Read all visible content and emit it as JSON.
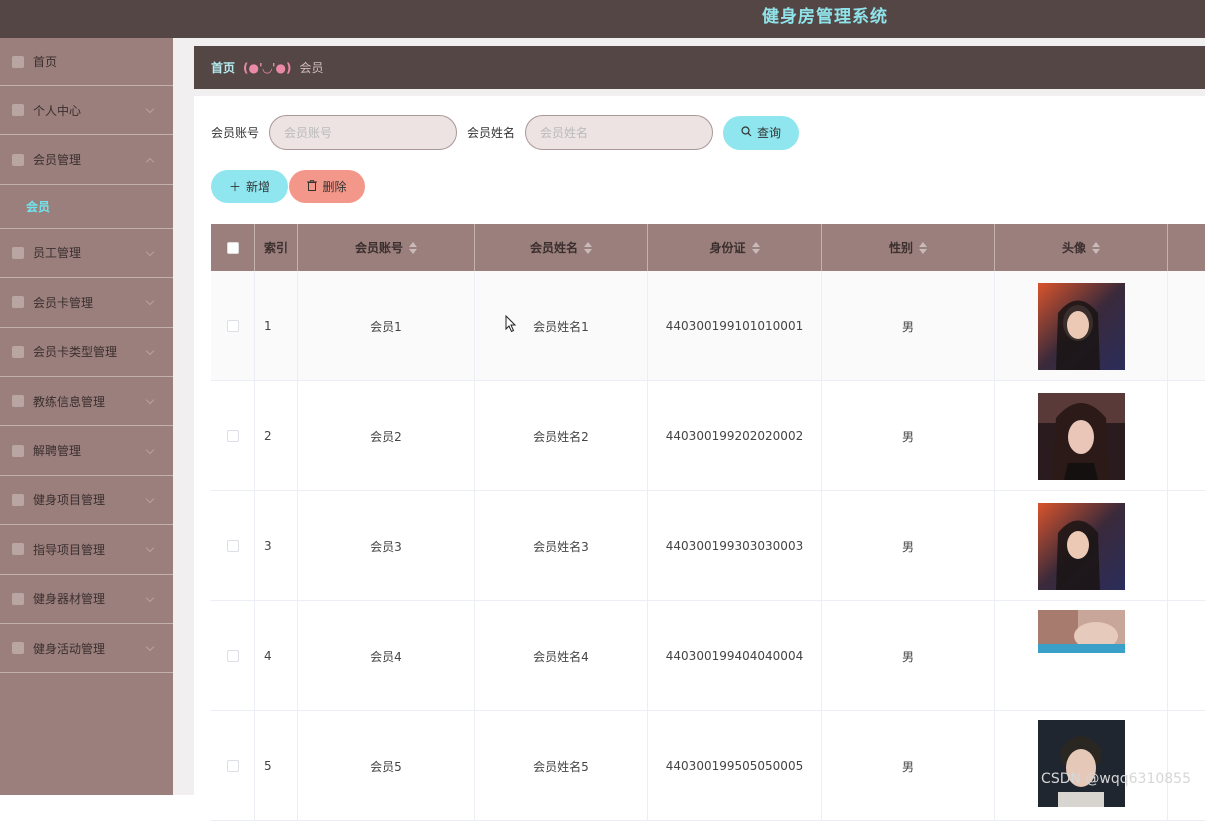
{
  "app": {
    "title": "健身房管理系统"
  },
  "sidebar": {
    "items": [
      {
        "label": "首页",
        "icon": "home-icon"
      },
      {
        "label": "个人中心",
        "icon": "user-icon"
      },
      {
        "label": "会员管理",
        "icon": "flag-icon"
      },
      {
        "label": "员工管理",
        "icon": "chat-icon"
      },
      {
        "label": "会员卡管理",
        "icon": "card-icon"
      },
      {
        "label": "会员卡类型管理",
        "icon": "list-icon"
      },
      {
        "label": "教练信息管理",
        "icon": "clock-icon"
      },
      {
        "label": "解聘管理",
        "icon": "send-icon"
      },
      {
        "label": "健身项目管理",
        "icon": "doc-icon"
      },
      {
        "label": "指导项目管理",
        "icon": "clipboard-icon"
      },
      {
        "label": "健身器材管理",
        "icon": "person-icon"
      },
      {
        "label": "健身活动管理",
        "icon": "calendar-icon"
      }
    ],
    "submenu_active": "会员"
  },
  "breadcrumb": {
    "home": "首页",
    "separator": "(●'◡'●)",
    "current": "会员"
  },
  "search": {
    "account_label": "会员账号",
    "account_placeholder": "会员账号",
    "name_label": "会员姓名",
    "name_placeholder": "会员姓名",
    "query_label": "查询"
  },
  "actions": {
    "add_label": "新增",
    "delete_label": "删除"
  },
  "table": {
    "headers": [
      "索引",
      "会员账号",
      "会员姓名",
      "身份证",
      "性别",
      "头像"
    ],
    "rows": [
      {
        "index": "1",
        "account": "会员1",
        "name": "会员姓名1",
        "id_card": "440300199101010001",
        "gender": "男"
      },
      {
        "index": "2",
        "account": "会员2",
        "name": "会员姓名2",
        "id_card": "440300199202020002",
        "gender": "男"
      },
      {
        "index": "3",
        "account": "会员3",
        "name": "会员姓名3",
        "id_card": "440300199303030003",
        "gender": "男"
      },
      {
        "index": "4",
        "account": "会员4",
        "name": "会员姓名4",
        "id_card": "440300199404040004",
        "gender": "男"
      },
      {
        "index": "5",
        "account": "会员5",
        "name": "会员姓名5",
        "id_card": "440300199505050005",
        "gender": "男"
      }
    ]
  },
  "watermark": "CSDN @wqq6310855",
  "colors": {
    "topbar": "#544644",
    "sidebar": "#9a7f7c",
    "accent": "#8fe6ee",
    "danger": "#f3978a",
    "title": "#8fe3ea"
  }
}
